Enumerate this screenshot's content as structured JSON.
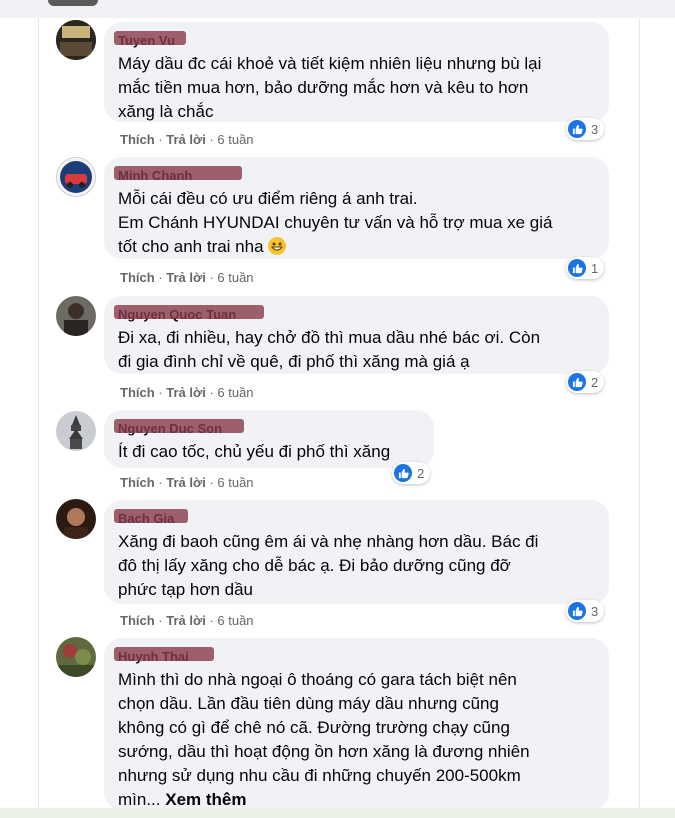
{
  "colors": {
    "like": "#1b74e4",
    "bubble": "#f0f2f5",
    "meta": "#65676b"
  },
  "like_label": "Thích",
  "reply_label": "Trả lời",
  "comments": [
    {
      "author": "Tuyen Vu",
      "lines": [
        "Máy dầu đc cái khoẻ và tiết kiệm nhiên liệu nhưng bù lại",
        "mắc tiền mua hơn, bảo dưỡng mắc hơn và kêu to hơn",
        "xăng là chắc"
      ],
      "time": "6 tuần",
      "reactions": "3"
    },
    {
      "author": "Minh Chanh",
      "lines": [
        "Mỗi cái đều có ưu điểm riêng á anh trai.",
        "Em Chánh HYUNDAI chuyên tư vấn và hỗ trợ mua xe giá",
        "tốt cho anh trai nha"
      ],
      "time": "6 tuần",
      "reactions": "1"
    },
    {
      "author": "Nguyen Quoc Tuan",
      "lines": [
        "Đi xa, đi nhiều, hay chở đồ thì mua dầu nhé bác ơi. Còn",
        "đi gia đình chỉ về quê, đi phố thì xăng mà giá ạ"
      ],
      "time": "6 tuần",
      "reactions": "2"
    },
    {
      "author": "Nguyen Duc Son",
      "lines": [
        "Ít đi cao tốc, chủ yếu đi phố thì xăng"
      ],
      "time": "6 tuần",
      "reactions": "2"
    },
    {
      "author": "Bach Gia",
      "lines": [
        "Xăng đi baoh cũng êm ái và nhẹ nhàng hơn dầu. Bác đi",
        "đô thị lấy xăng cho dễ bác ạ. Đi bảo dưỡng cũng đỡ",
        "phức tạp hơn dầu"
      ],
      "time": "6 tuần",
      "reactions": "3"
    },
    {
      "author": "Huynh Thai",
      "lines": [
        "Mình thì do nhà ngoại ô thoáng có gara tách biệt nên",
        "chọn dầu. Lần đầu tiên dùng máy dầu nhưng cũng",
        "không có gì để chê nó cã. Đường trường chạy cũng",
        "sướng, dầu thì hoạt động ồn hơn xăng là đương nhiên",
        "nhưng sử dụng nhu cầu đi những chuyến 200-500km",
        "mìn..."
      ],
      "see_more": "Xem thêm"
    }
  ]
}
